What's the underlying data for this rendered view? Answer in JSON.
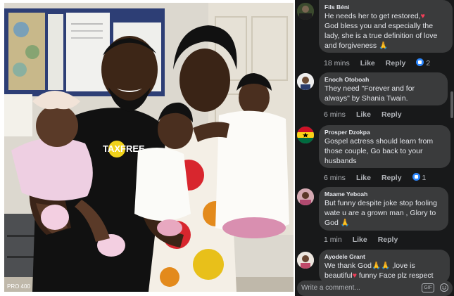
{
  "post": {
    "photo_alt": "family photo",
    "shirt_text": "TAXFREE",
    "corner_text": "PRO 400"
  },
  "comments": [
    {
      "author": "Fils Béni",
      "text_parts": [
        "He needs her to get restored,",
        "♥",
        "\nGod bless you and especially the lady, she is a true definition of love and forgiveness ",
        "🙏"
      ],
      "time": "18 mins",
      "like": "Like",
      "reply": "Reply",
      "reactions": "2"
    },
    {
      "author": "Enoch Otoboah",
      "text": "They need \"Forever and for always\" by Shania Twain.",
      "time": "6 mins",
      "like": "Like",
      "reply": "Reply"
    },
    {
      "author": "Prosper Dzokpa",
      "text": "Gospel actress should learn from those couple, Go back to your husbands",
      "time": "6 mins",
      "like": "Like",
      "reply": "Reply",
      "reactions": "1"
    },
    {
      "author": "Maame Yeboah",
      "text_parts": [
        "But funny despite joke stop fooling wate u are a grown man , Glory to God ",
        "🙏"
      ],
      "time": "1 min",
      "like": "Like",
      "reply": "Reply"
    },
    {
      "author": "Ayodele Grant",
      "text_parts": [
        "We thank God",
        "🙏🙏",
        " ,love is beautiful",
        "♥",
        " funny Face plz respect"
      ]
    }
  ],
  "composer": {
    "placeholder": "Write a comment...",
    "gif": "GIF"
  },
  "colors": {
    "panel_bg": "#18191a",
    "bubble_bg": "#3a3b3c",
    "text": "#e4e6eb",
    "meta": "#b0b3b8",
    "accent": "#2d88ff"
  }
}
